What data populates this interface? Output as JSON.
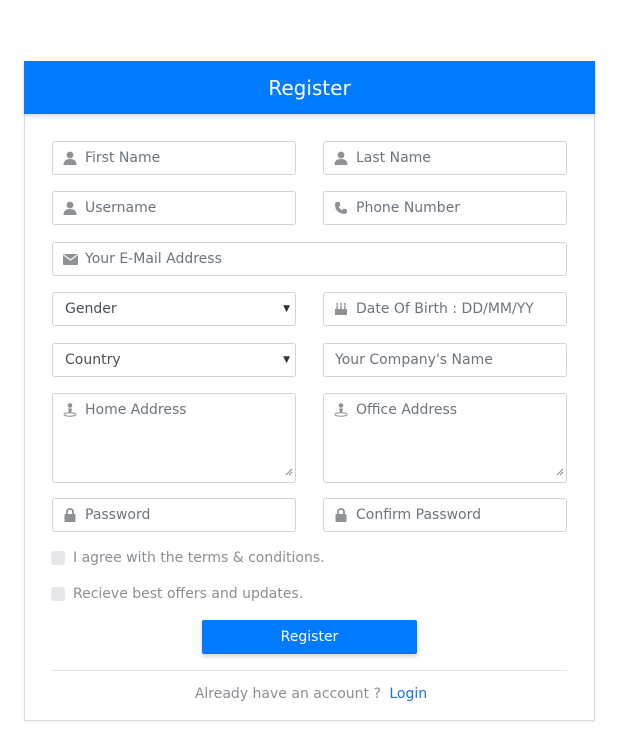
{
  "header": {
    "title": "Register"
  },
  "form": {
    "first_name": {
      "placeholder": "First Name",
      "icon": "user-icon"
    },
    "last_name": {
      "placeholder": "Last Name",
      "icon": "user-icon"
    },
    "username": {
      "placeholder": "Username",
      "icon": "user-icon"
    },
    "phone": {
      "placeholder": "Phone Number",
      "icon": "phone-icon"
    },
    "email": {
      "placeholder": "Your E-Mail Address",
      "icon": "envelope-icon"
    },
    "gender": {
      "selected": "Gender"
    },
    "dob": {
      "placeholder": "Date Of Birth : DD/MM/YY",
      "icon": "birthday-cake-icon"
    },
    "country": {
      "selected": "Country"
    },
    "company": {
      "placeholder": "Your Company's Name"
    },
    "home_address": {
      "placeholder": "Home Address",
      "icon": "map-marker-icon"
    },
    "office_address": {
      "placeholder": "Office Address",
      "icon": "map-marker-icon"
    },
    "password": {
      "placeholder": "Password",
      "icon": "lock-icon"
    },
    "confirm_password": {
      "placeholder": "Confirm Password",
      "icon": "lock-icon"
    },
    "terms_label": "I agree with the terms & conditions.",
    "offers_label": "Recieve best offers and updates.",
    "submit_label": "Register"
  },
  "footer": {
    "prompt": "Already have an account ?",
    "login_link": "Login"
  },
  "colors": {
    "primary": "#007bff",
    "link": "#1a73e8",
    "border": "#ced4da",
    "icon": "#8e9296"
  }
}
